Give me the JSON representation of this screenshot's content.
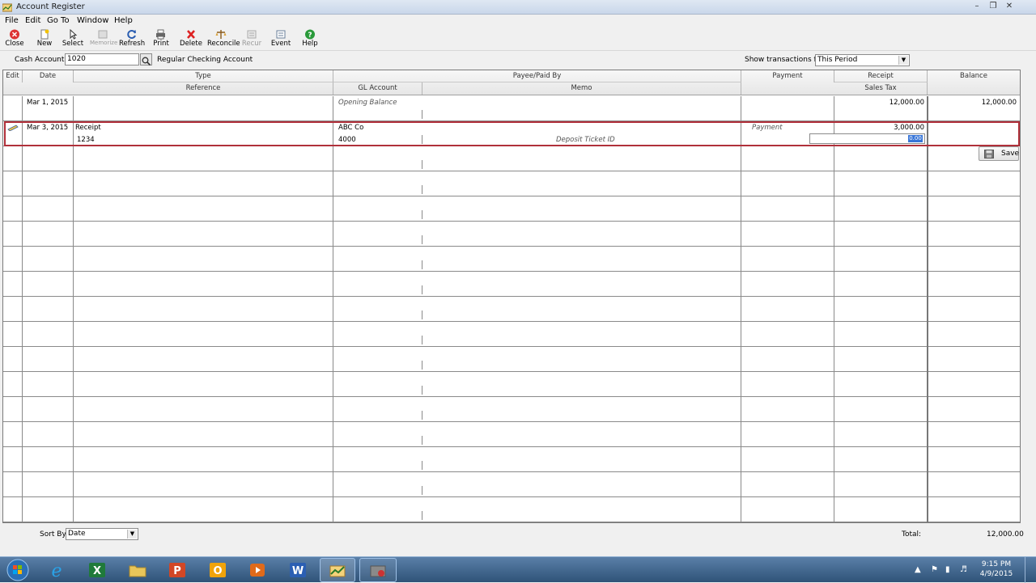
{
  "window": {
    "title": "Account Register"
  },
  "menu": [
    "File",
    "Edit",
    "Go To",
    "Window",
    "Help"
  ],
  "toolbar": [
    {
      "label": "Close",
      "icon": "close-icon",
      "enabled": true
    },
    {
      "label": "New",
      "icon": "new-icon",
      "enabled": true
    },
    {
      "label": "Select",
      "icon": "select-icon",
      "enabled": true
    },
    {
      "label": "Memorize",
      "icon": "memorize-icon",
      "enabled": false
    },
    {
      "label": "Refresh",
      "icon": "refresh-icon",
      "enabled": true
    },
    {
      "label": "Print",
      "icon": "print-icon",
      "enabled": true
    },
    {
      "label": "Delete",
      "icon": "delete-icon",
      "enabled": true
    },
    {
      "label": "Reconcile",
      "icon": "reconcile-icon",
      "enabled": true
    },
    {
      "label": "Recur",
      "icon": "recur-icon",
      "enabled": false
    },
    {
      "label": "Event",
      "icon": "event-icon",
      "enabled": true
    },
    {
      "label": "Help",
      "icon": "help-icon",
      "enabled": true
    }
  ],
  "account": {
    "cash_account_label": "Cash Account:",
    "cash_account_value": "1020",
    "account_name": "Regular Checking Account",
    "show_label": "Show transactions for:",
    "show_value": "This Period"
  },
  "columns": {
    "edit": "Edit",
    "date": "Date",
    "type": "Type",
    "reference": "Reference",
    "payee": "Payee/Paid By",
    "gl_account": "GL Account",
    "memo": "Memo",
    "payment": "Payment",
    "receipt": "Receipt",
    "sales_tax": "Sales Tax",
    "balance": "Balance"
  },
  "rows": [
    {
      "date": "Mar 1, 2015",
      "type": "",
      "reference": "",
      "payee": "Opening Balance",
      "gl_account": "",
      "memo": "",
      "payment": "",
      "receipt": "12,000.00",
      "sales_tax": "",
      "balance": "12,000.00"
    },
    {
      "date": "Mar 3, 2015",
      "type": "Receipt",
      "reference": "1234",
      "payee": "ABC Co",
      "gl_account": "4000",
      "memo": "Deposit Ticket ID",
      "payment": "Payment",
      "receipt": "3,000.00",
      "sales_tax": "0.00",
      "balance": ""
    }
  ],
  "save_label": "Save",
  "footer": {
    "sort_label": "Sort By:",
    "sort_value": "Date",
    "total_label": "Total:",
    "total_value": "12,000.00"
  },
  "taskbar": {
    "time": "9:15 PM",
    "date": "4/9/2015",
    "apps": [
      "start-orb-icon",
      "internet-explorer-icon",
      "excel-icon",
      "file-explorer-icon",
      "powerpoint-icon",
      "outlook-icon",
      "media-player-icon",
      "word-icon",
      "accounting-app-icon",
      "app-icon"
    ]
  },
  "colors": {
    "selection_border": "#b0303a",
    "highlight": "#3875d7"
  }
}
